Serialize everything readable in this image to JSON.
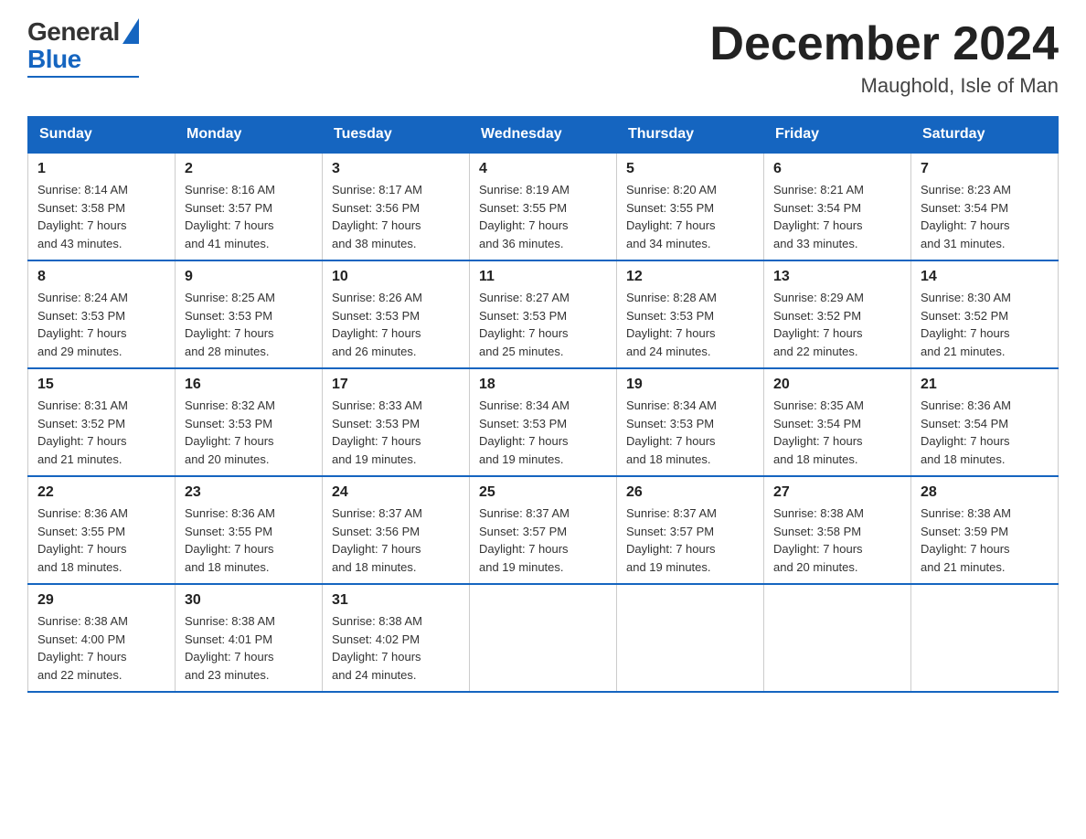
{
  "header": {
    "logo": {
      "general": "General",
      "blue": "Blue"
    },
    "title": "December 2024",
    "subtitle": "Maughold, Isle of Man"
  },
  "calendar": {
    "headers": [
      "Sunday",
      "Monday",
      "Tuesday",
      "Wednesday",
      "Thursday",
      "Friday",
      "Saturday"
    ],
    "weeks": [
      [
        {
          "day": "1",
          "sunrise": "Sunrise: 8:14 AM",
          "sunset": "Sunset: 3:58 PM",
          "daylight": "Daylight: 7 hours",
          "daylight2": "and 43 minutes."
        },
        {
          "day": "2",
          "sunrise": "Sunrise: 8:16 AM",
          "sunset": "Sunset: 3:57 PM",
          "daylight": "Daylight: 7 hours",
          "daylight2": "and 41 minutes."
        },
        {
          "day": "3",
          "sunrise": "Sunrise: 8:17 AM",
          "sunset": "Sunset: 3:56 PM",
          "daylight": "Daylight: 7 hours",
          "daylight2": "and 38 minutes."
        },
        {
          "day": "4",
          "sunrise": "Sunrise: 8:19 AM",
          "sunset": "Sunset: 3:55 PM",
          "daylight": "Daylight: 7 hours",
          "daylight2": "and 36 minutes."
        },
        {
          "day": "5",
          "sunrise": "Sunrise: 8:20 AM",
          "sunset": "Sunset: 3:55 PM",
          "daylight": "Daylight: 7 hours",
          "daylight2": "and 34 minutes."
        },
        {
          "day": "6",
          "sunrise": "Sunrise: 8:21 AM",
          "sunset": "Sunset: 3:54 PM",
          "daylight": "Daylight: 7 hours",
          "daylight2": "and 33 minutes."
        },
        {
          "day": "7",
          "sunrise": "Sunrise: 8:23 AM",
          "sunset": "Sunset: 3:54 PM",
          "daylight": "Daylight: 7 hours",
          "daylight2": "and 31 minutes."
        }
      ],
      [
        {
          "day": "8",
          "sunrise": "Sunrise: 8:24 AM",
          "sunset": "Sunset: 3:53 PM",
          "daylight": "Daylight: 7 hours",
          "daylight2": "and 29 minutes."
        },
        {
          "day": "9",
          "sunrise": "Sunrise: 8:25 AM",
          "sunset": "Sunset: 3:53 PM",
          "daylight": "Daylight: 7 hours",
          "daylight2": "and 28 minutes."
        },
        {
          "day": "10",
          "sunrise": "Sunrise: 8:26 AM",
          "sunset": "Sunset: 3:53 PM",
          "daylight": "Daylight: 7 hours",
          "daylight2": "and 26 minutes."
        },
        {
          "day": "11",
          "sunrise": "Sunrise: 8:27 AM",
          "sunset": "Sunset: 3:53 PM",
          "daylight": "Daylight: 7 hours",
          "daylight2": "and 25 minutes."
        },
        {
          "day": "12",
          "sunrise": "Sunrise: 8:28 AM",
          "sunset": "Sunset: 3:53 PM",
          "daylight": "Daylight: 7 hours",
          "daylight2": "and 24 minutes."
        },
        {
          "day": "13",
          "sunrise": "Sunrise: 8:29 AM",
          "sunset": "Sunset: 3:52 PM",
          "daylight": "Daylight: 7 hours",
          "daylight2": "and 22 minutes."
        },
        {
          "day": "14",
          "sunrise": "Sunrise: 8:30 AM",
          "sunset": "Sunset: 3:52 PM",
          "daylight": "Daylight: 7 hours",
          "daylight2": "and 21 minutes."
        }
      ],
      [
        {
          "day": "15",
          "sunrise": "Sunrise: 8:31 AM",
          "sunset": "Sunset: 3:52 PM",
          "daylight": "Daylight: 7 hours",
          "daylight2": "and 21 minutes."
        },
        {
          "day": "16",
          "sunrise": "Sunrise: 8:32 AM",
          "sunset": "Sunset: 3:53 PM",
          "daylight": "Daylight: 7 hours",
          "daylight2": "and 20 minutes."
        },
        {
          "day": "17",
          "sunrise": "Sunrise: 8:33 AM",
          "sunset": "Sunset: 3:53 PM",
          "daylight": "Daylight: 7 hours",
          "daylight2": "and 19 minutes."
        },
        {
          "day": "18",
          "sunrise": "Sunrise: 8:34 AM",
          "sunset": "Sunset: 3:53 PM",
          "daylight": "Daylight: 7 hours",
          "daylight2": "and 19 minutes."
        },
        {
          "day": "19",
          "sunrise": "Sunrise: 8:34 AM",
          "sunset": "Sunset: 3:53 PM",
          "daylight": "Daylight: 7 hours",
          "daylight2": "and 18 minutes."
        },
        {
          "day": "20",
          "sunrise": "Sunrise: 8:35 AM",
          "sunset": "Sunset: 3:54 PM",
          "daylight": "Daylight: 7 hours",
          "daylight2": "and 18 minutes."
        },
        {
          "day": "21",
          "sunrise": "Sunrise: 8:36 AM",
          "sunset": "Sunset: 3:54 PM",
          "daylight": "Daylight: 7 hours",
          "daylight2": "and 18 minutes."
        }
      ],
      [
        {
          "day": "22",
          "sunrise": "Sunrise: 8:36 AM",
          "sunset": "Sunset: 3:55 PM",
          "daylight": "Daylight: 7 hours",
          "daylight2": "and 18 minutes."
        },
        {
          "day": "23",
          "sunrise": "Sunrise: 8:36 AM",
          "sunset": "Sunset: 3:55 PM",
          "daylight": "Daylight: 7 hours",
          "daylight2": "and 18 minutes."
        },
        {
          "day": "24",
          "sunrise": "Sunrise: 8:37 AM",
          "sunset": "Sunset: 3:56 PM",
          "daylight": "Daylight: 7 hours",
          "daylight2": "and 18 minutes."
        },
        {
          "day": "25",
          "sunrise": "Sunrise: 8:37 AM",
          "sunset": "Sunset: 3:57 PM",
          "daylight": "Daylight: 7 hours",
          "daylight2": "and 19 minutes."
        },
        {
          "day": "26",
          "sunrise": "Sunrise: 8:37 AM",
          "sunset": "Sunset: 3:57 PM",
          "daylight": "Daylight: 7 hours",
          "daylight2": "and 19 minutes."
        },
        {
          "day": "27",
          "sunrise": "Sunrise: 8:38 AM",
          "sunset": "Sunset: 3:58 PM",
          "daylight": "Daylight: 7 hours",
          "daylight2": "and 20 minutes."
        },
        {
          "day": "28",
          "sunrise": "Sunrise: 8:38 AM",
          "sunset": "Sunset: 3:59 PM",
          "daylight": "Daylight: 7 hours",
          "daylight2": "and 21 minutes."
        }
      ],
      [
        {
          "day": "29",
          "sunrise": "Sunrise: 8:38 AM",
          "sunset": "Sunset: 4:00 PM",
          "daylight": "Daylight: 7 hours",
          "daylight2": "and 22 minutes."
        },
        {
          "day": "30",
          "sunrise": "Sunrise: 8:38 AM",
          "sunset": "Sunset: 4:01 PM",
          "daylight": "Daylight: 7 hours",
          "daylight2": "and 23 minutes."
        },
        {
          "day": "31",
          "sunrise": "Sunrise: 8:38 AM",
          "sunset": "Sunset: 4:02 PM",
          "daylight": "Daylight: 7 hours",
          "daylight2": "and 24 minutes."
        },
        null,
        null,
        null,
        null
      ]
    ]
  }
}
